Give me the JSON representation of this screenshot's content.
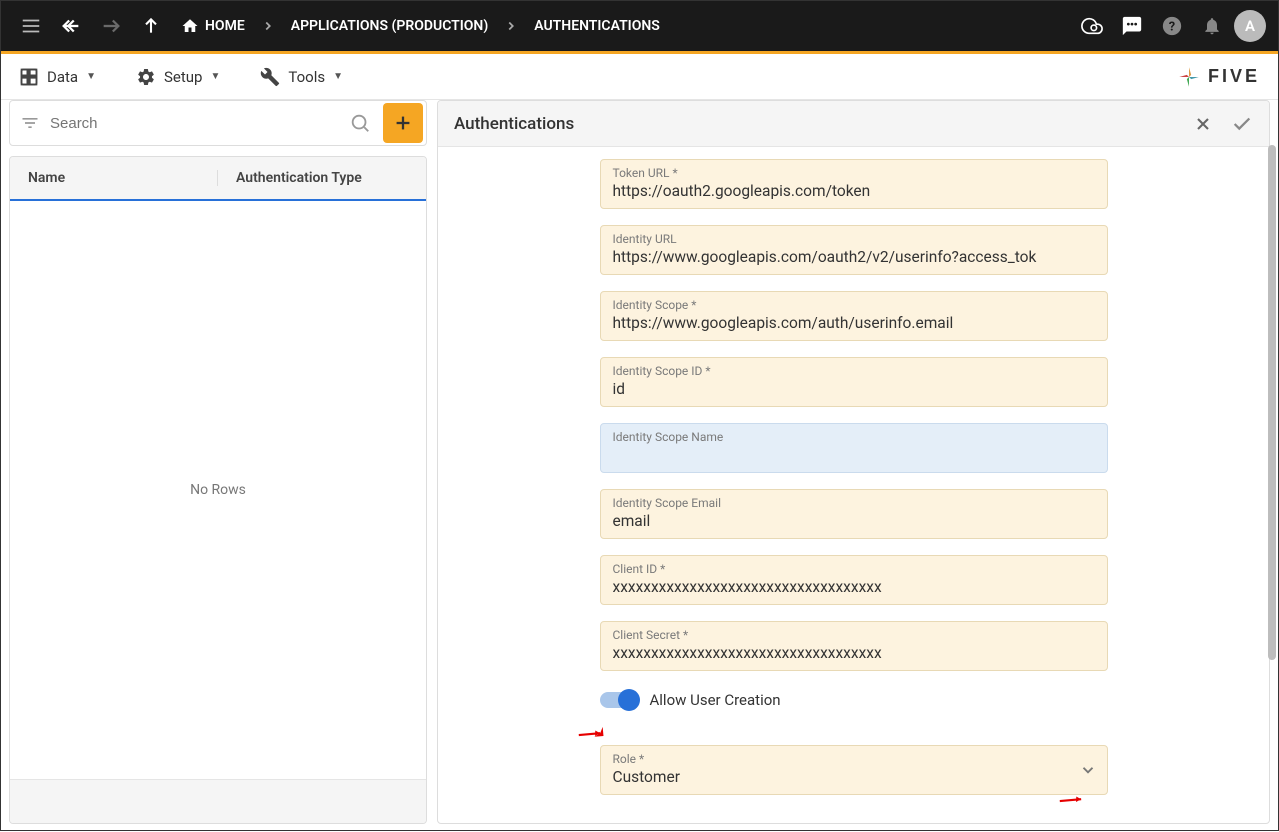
{
  "header": {
    "breadcrumbs": [
      "HOME",
      "APPLICATIONS (PRODUCTION)",
      "AUTHENTICATIONS"
    ],
    "avatar_initial": "A"
  },
  "menu": {
    "data": "Data",
    "setup": "Setup",
    "tools": "Tools"
  },
  "logo": {
    "text": "FIVE"
  },
  "search": {
    "placeholder": "Search"
  },
  "list": {
    "columns": [
      "Name",
      "Authentication Type"
    ],
    "empty_text": "No Rows"
  },
  "detail": {
    "title": "Authentications",
    "fields": {
      "token_url": {
        "label": "Token URL *",
        "value": "https://oauth2.googleapis.com/token"
      },
      "identity_url": {
        "label": "Identity URL",
        "value": "https://www.googleapis.com/oauth2/v2/userinfo?access_tok"
      },
      "identity_scope": {
        "label": "Identity Scope *",
        "value": "https://www.googleapis.com/auth/userinfo.email"
      },
      "identity_scope_id": {
        "label": "Identity Scope ID *",
        "value": "id"
      },
      "identity_scope_name": {
        "label": "Identity Scope Name",
        "value": ""
      },
      "identity_scope_email": {
        "label": "Identity Scope Email",
        "value": "email"
      },
      "client_id": {
        "label": "Client ID *",
        "value": "xxxxxxxxxxxxxxxxxxxxxxxxxxxxxxxxxxx"
      },
      "client_secret": {
        "label": "Client Secret *",
        "value": "xxxxxxxxxxxxxxxxxxxxxxxxxxxxxxxxxxx"
      },
      "role": {
        "label": "Role *",
        "value": "Customer"
      }
    },
    "toggle": {
      "label": "Allow User Creation",
      "on": true
    }
  }
}
